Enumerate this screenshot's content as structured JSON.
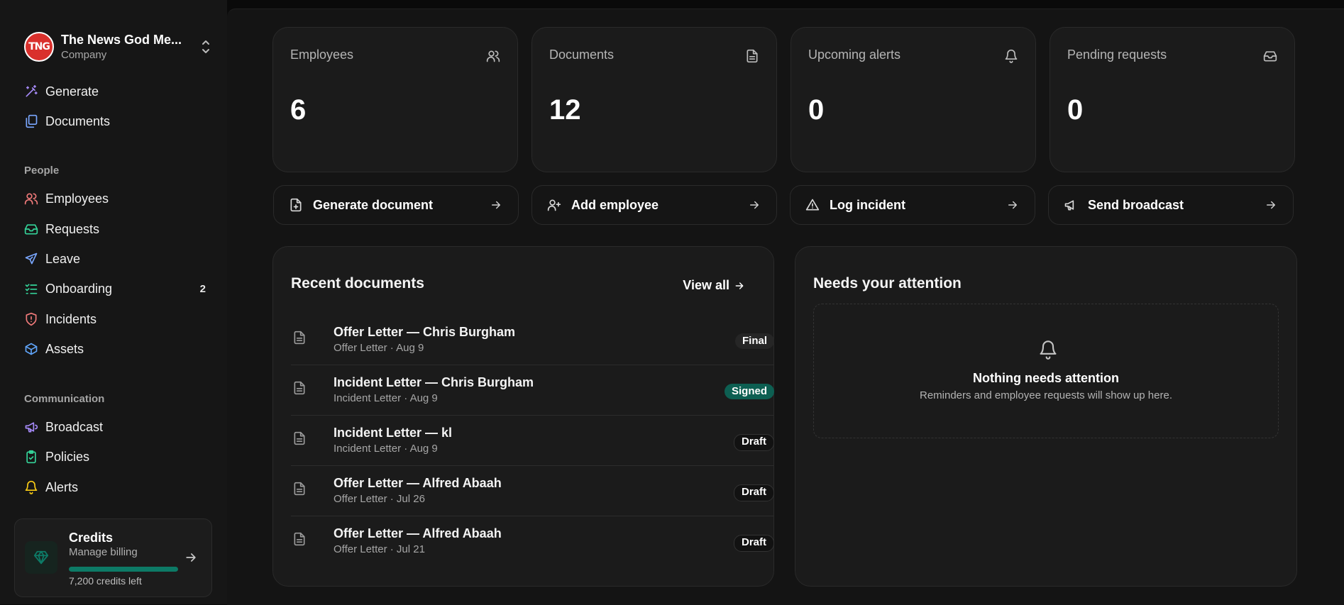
{
  "brand": {
    "logo_text": "TNG",
    "name": "The News God Me...",
    "subtitle": "Company"
  },
  "nav_top": [
    {
      "label": "Generate",
      "icon": "magic-wand-icon",
      "color": "#a78bfa"
    },
    {
      "label": "Documents",
      "icon": "documents-icon",
      "color": "#7aa7ff"
    }
  ],
  "section_people": "People",
  "nav_people": [
    {
      "label": "Employees",
      "icon": "users-icon",
      "color": "#f07a7a"
    },
    {
      "label": "Requests",
      "icon": "inbox-icon",
      "color": "#34d399"
    },
    {
      "label": "Leave",
      "icon": "plane-icon",
      "color": "#7aa7ff"
    },
    {
      "label": "Onboarding",
      "icon": "checklist-icon",
      "color": "#34d399",
      "count": "2"
    },
    {
      "label": "Incidents",
      "icon": "shield-alert-icon",
      "color": "#f07a7a"
    },
    {
      "label": "Assets",
      "icon": "box-icon",
      "color": "#60a5fa"
    }
  ],
  "section_communication": "Communication",
  "nav_communication": [
    {
      "label": "Broadcast",
      "icon": "megaphone-icon",
      "color": "#a78bfa"
    },
    {
      "label": "Policies",
      "icon": "clipboard-check-icon",
      "color": "#34d399"
    },
    {
      "label": "Alerts",
      "icon": "bell-icon",
      "color": "#facc15"
    }
  ],
  "credits": {
    "title": "Credits",
    "subtitle": "Manage billing",
    "remaining": "7,200 credits left",
    "progress": 1.0,
    "accent": "#0d7a66"
  },
  "stats": [
    {
      "label": "Employees",
      "value": "6",
      "icon": "users-icon"
    },
    {
      "label": "Documents",
      "value": "12",
      "icon": "file-icon"
    },
    {
      "label": "Upcoming alerts",
      "value": "0",
      "icon": "bell-icon"
    },
    {
      "label": "Pending requests",
      "value": "0",
      "icon": "inbox-icon"
    }
  ],
  "actions": [
    {
      "label": "Generate document",
      "icon": "file-plus-icon"
    },
    {
      "label": "Add employee",
      "icon": "user-plus-icon"
    },
    {
      "label": "Log incident",
      "icon": "warning-icon"
    },
    {
      "label": "Send broadcast",
      "icon": "megaphone-icon"
    }
  ],
  "recent": {
    "title": "Recent documents",
    "view_all": "View all",
    "items": [
      {
        "title": "Offer Letter — Chris Burgham",
        "meta": "Offer Letter · Aug 9",
        "status": "Final"
      },
      {
        "title": "Incident Letter — Chris Burgham",
        "meta": "Incident Letter · Aug 9",
        "status": "Signed"
      },
      {
        "title": "Incident Letter — kl",
        "meta": "Incident Letter · Aug 9",
        "status": "Draft"
      },
      {
        "title": "Offer Letter — Alfred Abaah",
        "meta": "Offer Letter · Jul 26",
        "status": "Draft"
      },
      {
        "title": "Offer Letter — Alfred Abaah",
        "meta": "Offer Letter · Jul 21",
        "status": "Draft"
      }
    ]
  },
  "attention": {
    "title": "Needs your attention",
    "empty_title": "Nothing needs attention",
    "empty_subtitle": "Reminders and employee requests will show up here."
  }
}
